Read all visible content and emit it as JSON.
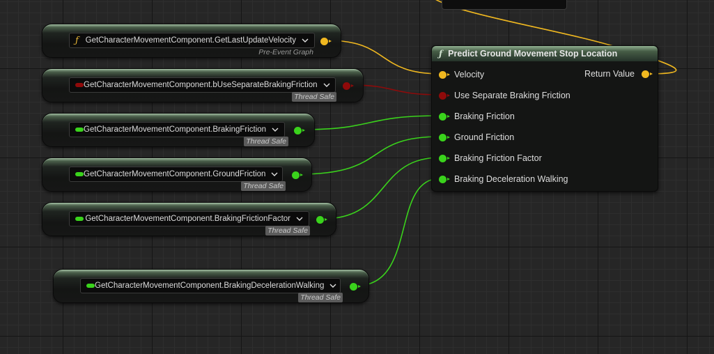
{
  "colors": {
    "vector_pin": "#f0b820",
    "bool_pin": "#8f0a0a",
    "float_pin": "#3ad31c"
  },
  "getters": [
    {
      "label": "GetCharacterMovementComponent.GetLastUpdateVelocity",
      "tag": "Pre-Event Graph",
      "pin_type": "vector",
      "symbol": "function-icon",
      "symbol_text": "ƒ"
    },
    {
      "label": "GetCharacterMovementComponent.bUseSeparateBrakingFriction",
      "tag": "Thread Safe",
      "pin_type": "bool"
    },
    {
      "label": "GetCharacterMovementComponent.BrakingFriction",
      "tag": "Thread Safe",
      "pin_type": "float"
    },
    {
      "label": "GetCharacterMovementComponent.GroundFriction",
      "tag": "Thread Safe",
      "pin_type": "float"
    },
    {
      "label": "GetCharacterMovementComponent.BrakingFrictionFactor",
      "tag": "Thread Safe",
      "pin_type": "float"
    },
    {
      "label": "GetCharacterMovementComponent.BrakingDecelerationWalking",
      "tag": "Thread Safe",
      "pin_type": "float"
    }
  ],
  "function_node": {
    "icon_text": "ƒ",
    "title": "Predict Ground Movement Stop Location",
    "inputs": [
      {
        "label": "Velocity",
        "pin_type": "vector"
      },
      {
        "label": "Use Separate Braking Friction",
        "pin_type": "bool"
      },
      {
        "label": "Braking Friction",
        "pin_type": "float"
      },
      {
        "label": "Ground Friction",
        "pin_type": "float"
      },
      {
        "label": "Braking Friction Factor",
        "pin_type": "float"
      },
      {
        "label": "Braking Deceleration Walking",
        "pin_type": "float"
      }
    ],
    "output": {
      "label": "Return Value",
      "pin_type": "vector"
    }
  }
}
